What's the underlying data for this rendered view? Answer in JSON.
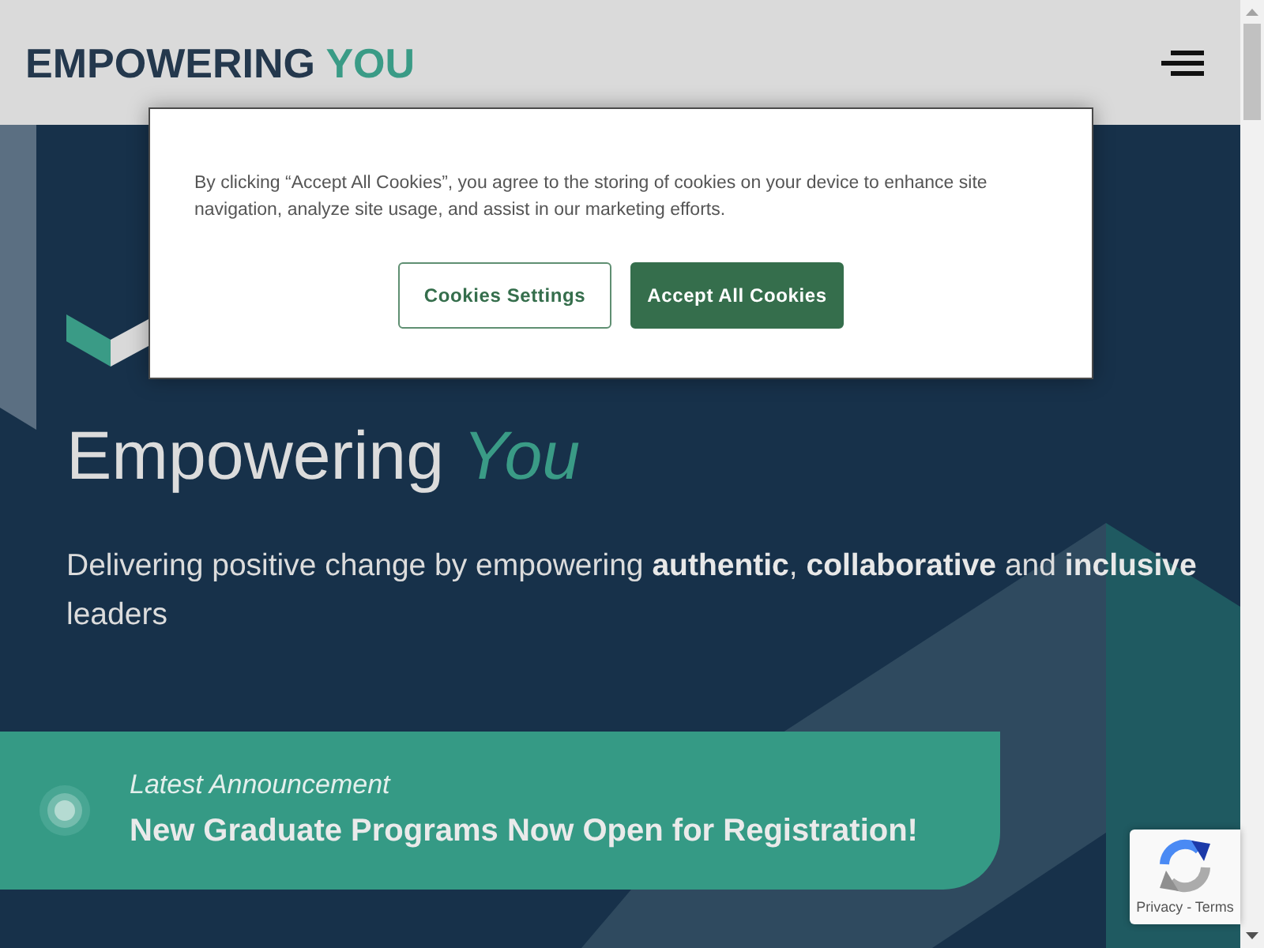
{
  "header": {
    "logo": {
      "primary": "EMPOWERING",
      "accent": "YOU"
    }
  },
  "cookie_banner": {
    "text": "By clicking “Accept All Cookies”, you agree to the storing of cookies on your device to enhance site navigation, analyze site usage, and assist in our marketing efforts.",
    "buttons": [
      {
        "label": "Cookies Settings",
        "kind": "secondary"
      },
      {
        "label": "Accept All Cookies",
        "kind": "primary"
      }
    ]
  },
  "hero": {
    "heading": "Empowering *You*",
    "subheading": "Delivering positive change by empowering **authentic**, **collaborative** and **inclusive** leaders"
  },
  "announcement": {
    "label": "Latest Announcement",
    "title": "New Graduate Programs Now Open for Registration!"
  },
  "recaptcha": {
    "links": "Privacy - Terms"
  }
}
